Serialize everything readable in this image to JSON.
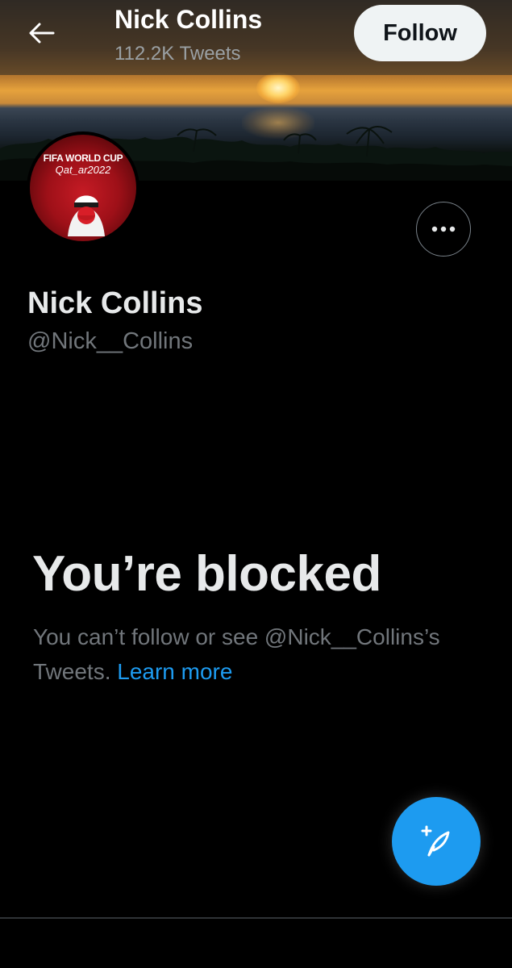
{
  "header": {
    "title": "Nick Collins",
    "subtitle": "112.2K Tweets",
    "back_icon": "arrow-left-icon",
    "follow_label": "Follow"
  },
  "banner": {
    "image": "sunset-over-ocean-with-palm-trees"
  },
  "avatar": {
    "logo_line1": "FIFA WORLD CUP",
    "logo_line2": "Qat_ar2022",
    "accent_color": "#c61b25"
  },
  "profile": {
    "name": "Nick Collins",
    "handle": "@Nick__Collins",
    "more_icon": "more-horizontal-icon"
  },
  "blocked": {
    "title": "You’re blocked",
    "message": "You can’t follow or see @Nick__Collins’s Tweets.",
    "learn_more": "Learn more"
  },
  "compose": {
    "icon": "compose-tweet-icon"
  },
  "colors": {
    "background": "#000000",
    "primary_text": "#e7e9ea",
    "secondary_text": "#71767b",
    "link": "#1d9bf0",
    "fab": "#1d9bf0",
    "follow_button_bg": "#eff3f4"
  }
}
